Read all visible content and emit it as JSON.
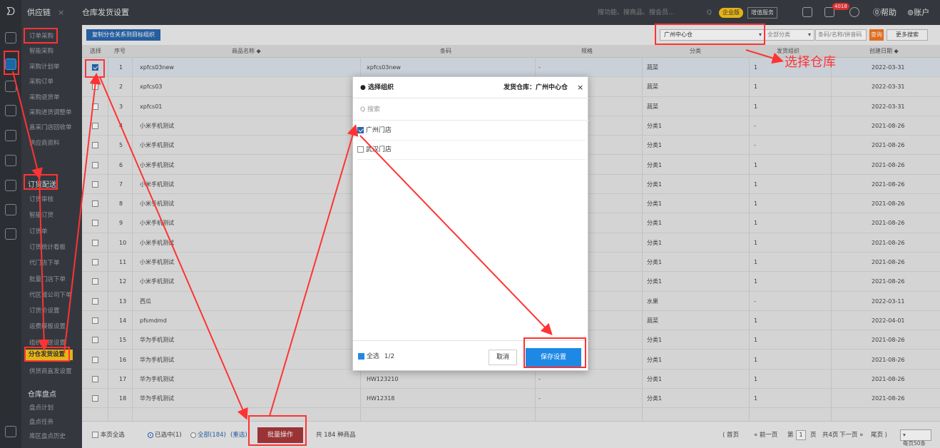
{
  "app": {
    "module_tab": "供应链",
    "close_glyph": "×",
    "page_tab": "仓库发货设置"
  },
  "topbar": {
    "search_placeholder": "搜功能、搜商品、搜会员...",
    "enterprise_badge": "企业版",
    "value_added": "增值服务",
    "notice_count": "4018",
    "help": "帮助",
    "account": "账户"
  },
  "sidebar": {
    "items_a": [
      "订单采购",
      "智能采购",
      "采购计划单",
      "采购订单",
      "采购退货单",
      "采购进货调整单",
      "直采门店回收单",
      "供应商资料"
    ],
    "section_order": "订货配送",
    "items_b": [
      "订货审核",
      "智能订货",
      "订货单",
      "订货统计看板",
      "代门店下单",
      "批量门店下单",
      "代区域公司下单",
      "订货价设置",
      "运费模板设置",
      "组织配送设置"
    ],
    "active_item": "分仓发货设置",
    "items_c": [
      "供货商直发设置"
    ],
    "section_inventory": "仓库盘点",
    "items_d": [
      "盘点计划",
      "盘点任务",
      "库区盘点历史"
    ]
  },
  "toolbar": {
    "copy_button": "复制分仓关系到目标组织",
    "warehouse_select": "广州中心仓",
    "category_select": "全部分类",
    "keyword_placeholder": "条码/名称/拼音码",
    "query_button": "查询",
    "more_search": "更多搜索"
  },
  "table": {
    "headers": {
      "select": "选择",
      "seq": "序号",
      "name": "商品名称 ◆",
      "barcode": "条码",
      "spec": "规格",
      "category": "分类",
      "ship_org": "发货组织",
      "created": "创建日期 ◆"
    },
    "rows": [
      {
        "seq": "1",
        "name": "xpfcs03new",
        "barcode": "xpfcs03new",
        "spec": "-",
        "category": "蔬菜",
        "ship": "1",
        "date": "2022-03-31",
        "checked": true
      },
      {
        "seq": "2",
        "name": "xpfcs03",
        "barcode": "",
        "spec": "",
        "category": "蔬菜",
        "ship": "1",
        "date": "2022-03-31",
        "checked": false
      },
      {
        "seq": "3",
        "name": "xpfcs01",
        "barcode": "",
        "spec": "",
        "category": "蔬菜",
        "ship": "1",
        "date": "2022-03-31",
        "checked": false
      },
      {
        "seq": "4",
        "name": "小米手机测试",
        "barcode": "",
        "spec": "",
        "category": "分类1",
        "ship": "-",
        "date": "2021-08-26",
        "checked": false
      },
      {
        "seq": "5",
        "name": "小米手机测试",
        "barcode": "",
        "spec": "",
        "category": "分类1",
        "ship": "-",
        "date": "2021-08-26",
        "checked": false
      },
      {
        "seq": "6",
        "name": "小米手机测试",
        "barcode": "",
        "spec": "",
        "category": "分类1",
        "ship": "1",
        "date": "2021-08-26",
        "checked": false
      },
      {
        "seq": "7",
        "name": "小米手机测试",
        "barcode": "",
        "spec": "",
        "category": "分类1",
        "ship": "1",
        "date": "2021-08-26",
        "checked": false
      },
      {
        "seq": "8",
        "name": "小米手机测试",
        "barcode": "",
        "spec": "",
        "category": "分类1",
        "ship": "1",
        "date": "2021-08-26",
        "checked": false
      },
      {
        "seq": "9",
        "name": "小米手机测试",
        "barcode": "",
        "spec": "",
        "category": "分类1",
        "ship": "1",
        "date": "2021-08-26",
        "checked": false
      },
      {
        "seq": "10",
        "name": "小米手机测试",
        "barcode": "",
        "spec": "",
        "category": "分类1",
        "ship": "1",
        "date": "2021-08-26",
        "checked": false
      },
      {
        "seq": "11",
        "name": "小米手机测试",
        "barcode": "",
        "spec": "",
        "category": "分类1",
        "ship": "1",
        "date": "2021-08-26",
        "checked": false
      },
      {
        "seq": "12",
        "name": "小米手机测试",
        "barcode": "",
        "spec": "",
        "category": "分类1",
        "ship": "1",
        "date": "2021-08-26",
        "checked": false
      },
      {
        "seq": "13",
        "name": "西瓜",
        "barcode": "",
        "spec": "",
        "category": "水果",
        "ship": "-",
        "date": "2022-03-11",
        "checked": false
      },
      {
        "seq": "14",
        "name": "pfsmdmd",
        "barcode": "",
        "spec": "",
        "category": "蔬菜",
        "ship": "1",
        "date": "2022-04-01",
        "checked": false
      },
      {
        "seq": "15",
        "name": "华为手机测试",
        "barcode": "",
        "spec": "",
        "category": "分类1",
        "ship": "1",
        "date": "2021-08-26",
        "checked": false
      },
      {
        "seq": "16",
        "name": "华为手机测试",
        "barcode": "",
        "spec": "",
        "category": "分类1",
        "ship": "1",
        "date": "2021-08-26",
        "checked": false
      },
      {
        "seq": "17",
        "name": "华为手机测试",
        "barcode": "HW123210",
        "spec": "-",
        "category": "分类1",
        "ship": "1",
        "date": "2021-08-26",
        "checked": false
      },
      {
        "seq": "18",
        "name": "华为手机测试",
        "barcode": "HW12318",
        "spec": "-",
        "category": "分类1",
        "ship": "1",
        "date": "2021-08-26",
        "checked": false
      }
    ]
  },
  "footer": {
    "page_select_all": "本页全选",
    "selected": "已选中(1)",
    "all": "全部(184)",
    "reselect": "(重选)",
    "batch_button": "批量操作",
    "total": "共 184 种商品",
    "first": "首页",
    "prev": "前一页",
    "page_label_pre": "第",
    "page_value": "1",
    "page_label_post": "页",
    "total_pages": "共4页",
    "next": "下一页",
    "last": "尾页",
    "page_size": "每页50条"
  },
  "dialog": {
    "title": "● 选择组织",
    "warehouse_label": "发货仓库：广州中心仓",
    "close": "×",
    "search_placeholder": "搜索",
    "orgs": [
      {
        "name": "广州门店",
        "checked": true
      },
      {
        "name": "武汉门店",
        "checked": false
      }
    ],
    "select_all": "全选",
    "count": "1/2",
    "cancel": "取消",
    "save": "保存设置"
  },
  "annotation": {
    "text": "选择仓库",
    "color": "#ff3333"
  }
}
